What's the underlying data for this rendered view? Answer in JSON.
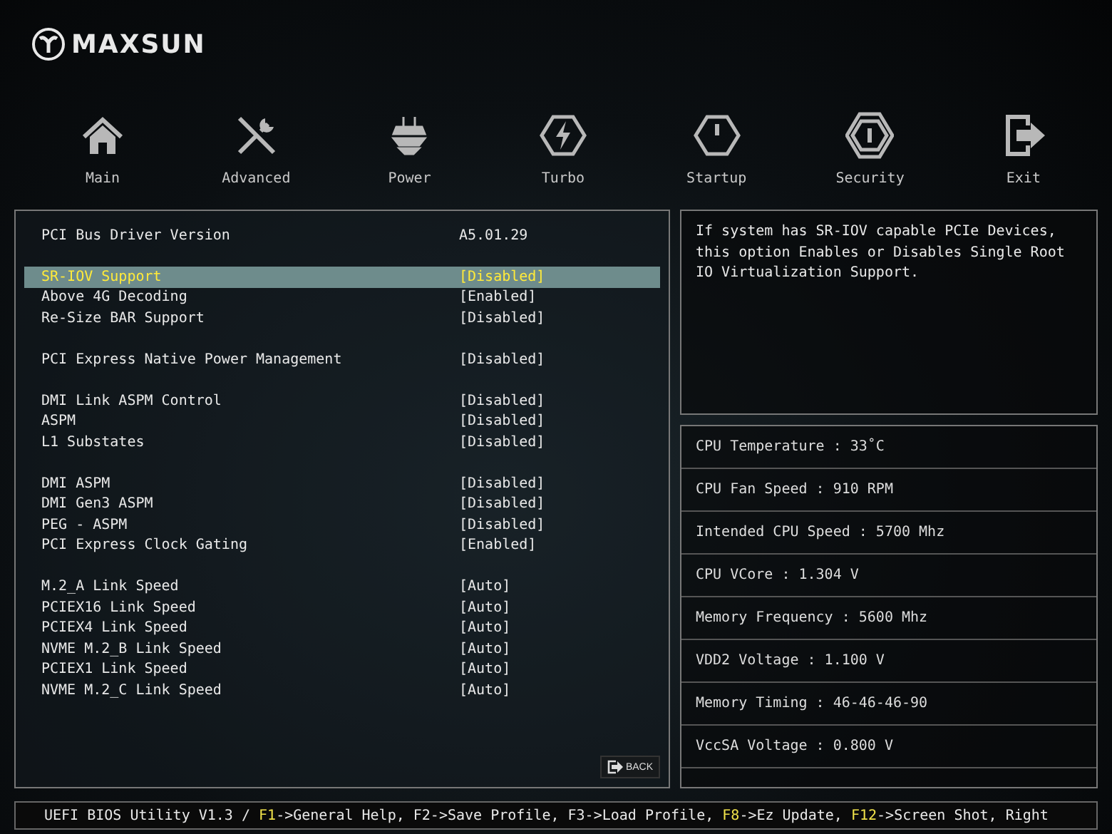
{
  "brand": {
    "name": "MAXSUN"
  },
  "tabs": [
    {
      "label": "Main",
      "selected": false
    },
    {
      "label": "Advanced",
      "selected": false
    },
    {
      "label": "Power",
      "selected": false
    },
    {
      "label": "Turbo",
      "selected": false
    },
    {
      "label": "Startup",
      "selected": false
    },
    {
      "label": "Security",
      "selected": false
    },
    {
      "label": "Exit",
      "selected": false
    }
  ],
  "settings": {
    "groups": [
      {
        "items": [
          {
            "label": "PCI Bus Driver Version",
            "value": "A5.01.29",
            "selected": false
          }
        ]
      },
      {
        "items": [
          {
            "label": "SR-IOV Support",
            "value": "[Disabled]",
            "selected": true
          },
          {
            "label": "Above 4G Decoding",
            "value": "[Enabled]",
            "selected": false
          },
          {
            "label": "Re-Size BAR Support",
            "value": "[Disabled]",
            "selected": false
          }
        ]
      },
      {
        "items": [
          {
            "label": "PCI Express Native Power Management",
            "value": "[Disabled]",
            "selected": false
          }
        ]
      },
      {
        "items": [
          {
            "label": "DMI Link ASPM Control",
            "value": "[Disabled]",
            "selected": false
          },
          {
            "label": "ASPM",
            "value": "[Disabled]",
            "selected": false
          },
          {
            "label": "L1 Substates",
            "value": "[Disabled]",
            "selected": false
          }
        ]
      },
      {
        "items": [
          {
            "label": "DMI ASPM",
            "value": "[Disabled]",
            "selected": false
          },
          {
            "label": "DMI Gen3 ASPM",
            "value": "[Disabled]",
            "selected": false
          },
          {
            "label": "PEG - ASPM",
            "value": "[Disabled]",
            "selected": false
          },
          {
            "label": "PCI Express Clock Gating",
            "value": "[Enabled]",
            "selected": false
          }
        ]
      },
      {
        "items": [
          {
            "label": "M.2_A Link Speed",
            "value": "[Auto]",
            "selected": false
          },
          {
            "label": "PCIEX16 Link Speed",
            "value": "[Auto]",
            "selected": false
          },
          {
            "label": "PCIEX4 Link Speed",
            "value": "[Auto]",
            "selected": false
          },
          {
            "label": "NVME M.2_B Link Speed",
            "value": "[Auto]",
            "selected": false
          },
          {
            "label": "PCIEX1 Link Speed",
            "value": "[Auto]",
            "selected": false
          },
          {
            "label": "NVME M.2_C Link Speed",
            "value": "[Auto]",
            "selected": false
          }
        ]
      }
    ],
    "back_button": "BACK"
  },
  "help": {
    "text": "If system has SR-IOV capable PCIe Devices, this option Enables or Disables Single Root IO Virtualization Support."
  },
  "monitor": [
    "CPU Temperature : 33˚C",
    "CPU Fan Speed : 910 RPM",
    "Intended CPU Speed : 5700 Mhz",
    "CPU VCore : 1.304 V",
    "Memory Frequency : 5600 Mhz",
    "VDD2 Voltage : 1.100 V",
    "Memory Timing : 46-46-46-90",
    "VccSA Voltage : 0.800 V"
  ],
  "status_bar": {
    "segments": [
      {
        "text": "UEFI BIOS Utility V1.3 / ",
        "highlight": false
      },
      {
        "text": "F1",
        "highlight": true
      },
      {
        "text": "->General Help, F2->Save Profile, F3->Load Profile, ",
        "highlight": false
      },
      {
        "text": "F8",
        "highlight": true
      },
      {
        "text": "->Ez Update, ",
        "highlight": false
      },
      {
        "text": "F12",
        "highlight": true
      },
      {
        "text": "->Screen Shot, Right",
        "highlight": false
      }
    ]
  }
}
